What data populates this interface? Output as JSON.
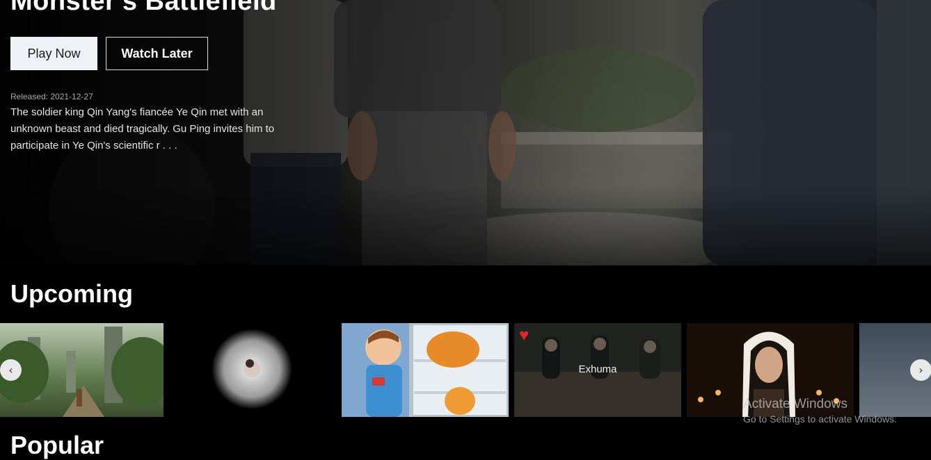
{
  "hero": {
    "title": "Monster's Battlefield",
    "play_label": "Play Now",
    "watch_later_label": "Watch Later",
    "released": "Released: 2021-12-27",
    "overview": "The soldier king Qin Yang's fiancée Ye Qin met with an unknown beast and died tragically. Gu Ping invites him to participate in Ye Qin's scientific r . . ."
  },
  "upcoming": {
    "title": "Upcoming",
    "cards": [
      {
        "label": ""
      },
      {
        "label": ""
      },
      {
        "label": ""
      },
      {
        "label": "Exhuma"
      },
      {
        "label": ""
      },
      {
        "label": ""
      }
    ],
    "prev_icon": "‹",
    "next_icon": "›"
  },
  "popular": {
    "title": "Popular"
  },
  "watermark": {
    "title": "Activate Windows",
    "subtitle": "Go to Settings to activate Windows."
  },
  "colors": {
    "background": "#000000",
    "play_button_bg": "#eef1f6"
  }
}
